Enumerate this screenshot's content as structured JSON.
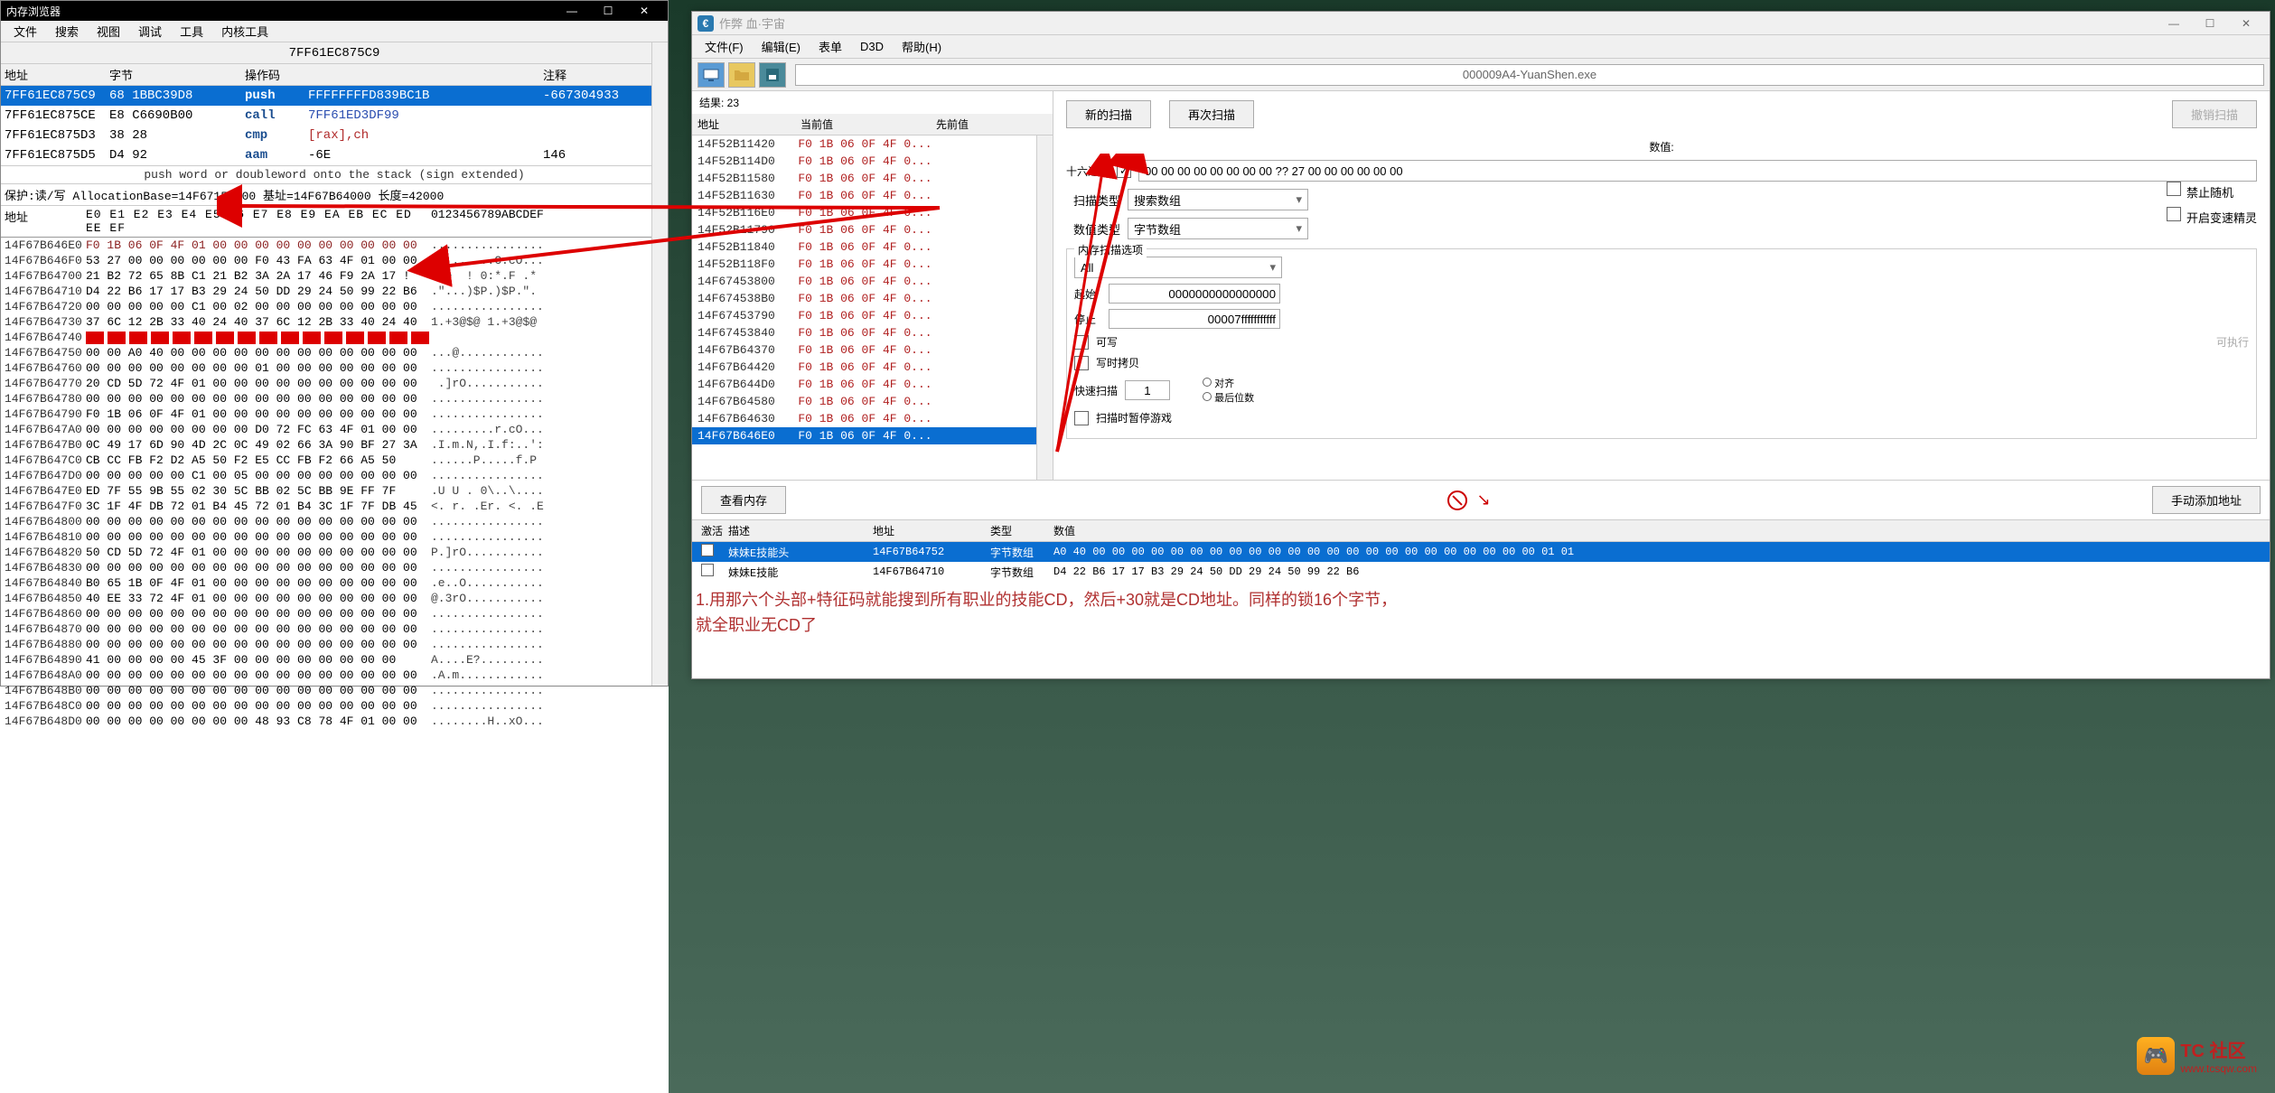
{
  "left": {
    "title": "内存浏览器",
    "menu": [
      "文件",
      "搜索",
      "视图",
      "调试",
      "工具",
      "内核工具"
    ],
    "addr_bar": "7FF61EC875C9",
    "disasm_headers": [
      "地址",
      "字节",
      "操作码",
      "",
      "注释"
    ],
    "disasm": [
      {
        "addr": "7FF61EC875C9",
        "bytes": "68 1BBC39D8",
        "op": "push",
        "operand": "FFFFFFFFD839BC1B",
        "operand_cls": "op-green",
        "comment": "-667304933",
        "sel": true
      },
      {
        "addr": "7FF61EC875CE",
        "bytes": "E8 C6690B00",
        "op": "call",
        "operand": "7FF61ED3DF99",
        "operand_cls": "op-blue",
        "comment": ""
      },
      {
        "addr": "7FF61EC875D3",
        "bytes": "38 28",
        "op": "cmp",
        "operand": "[rax],ch",
        "operand_cls": "op-red",
        "comment": ""
      },
      {
        "addr": "7FF61EC875D5",
        "bytes": "D4 92",
        "op": "aam",
        "operand": "-6E",
        "operand_cls": "",
        "comment": "146"
      }
    ],
    "push_hint": "push word or doubleword onto the stack (sign extended)",
    "alloc": "保护:读/写  AllocationBase=14F67150000  基址=14F67B64000 长度=42000",
    "hex_header_addr": "地址",
    "hex_header_bytes": "E0 E1 E2 E3 E4 E5 E6 E7 E8 E9 EA EB EC ED EE EF",
    "hex_header_ascii": "0123456789ABCDEF",
    "hex": [
      {
        "a": "14F67B646E0",
        "b": "F0 1B 06 0F 4F 01 00 00 00 00 00 00 00 00 00 00",
        "c": "................",
        "br": true
      },
      {
        "a": "14F67B646F0",
        "b": "53 27 00 00 00 00 00 00 F0 43 FA 63 4F 01 00 00",
        "c": "S'.......C.cO..."
      },
      {
        "a": "14F67B64700",
        "b": "21 B2 72 65 8B C1 21 B2 3A 2A 17 46 F9 2A 17 !",
        "c": " re  ! 0:*.F .*"
      },
      {
        "a": "14F67B64710",
        "b": "D4 22 B6 17 17 B3 29 24 50 DD 29 24 50 99 22 B6",
        "c": ".\"...)$P.)$P.\"."
      },
      {
        "a": "14F67B64720",
        "b": "00 00 00 00 00 C1 00 02 00 00 00 00 00 00 00 00",
        "c": "................"
      },
      {
        "a": "14F67B64730",
        "b": "37 6C 12 2B 33 40 24 40 37 6C 12 2B 33 40 24 40",
        "c": "1.+3@$@ 1.+3@$@",
        "red": true
      },
      {
        "a": "14F67B64740",
        "b": "",
        "c": "",
        "redbar": true
      },
      {
        "a": "14F67B64750",
        "b": "00 00 A0 40 00 00 00 00 00 00 00 00 00 00 00 00",
        "c": "...@............"
      },
      {
        "a": "14F67B64760",
        "b": "00 00 00 00 00 00 00 00 01 00 00 00 00 00 00 00",
        "c": "................"
      },
      {
        "a": "14F67B64770",
        "b": "20 CD 5D 72 4F 01 00 00 00 00 00 00 00 00 00 00",
        "c": " .]rO..........."
      },
      {
        "a": "14F67B64780",
        "b": "00 00 00 00 00 00 00 00 00 00 00 00 00 00 00 00",
        "c": "................"
      },
      {
        "a": "14F67B64790",
        "b": "F0 1B 06 0F 4F 01 00 00 00 00 00 00 00 00 00 00",
        "c": "................"
      },
      {
        "a": "14F67B647A0",
        "b": "00 00 00 00 00 00 00 00 D0 72 FC 63 4F 01 00 00",
        "c": ".........r.cO..."
      },
      {
        "a": "14F67B647B0",
        "b": "0C 49 17 6D 90 4D 2C 0C 49 02 66 3A 90 BF 27 3A",
        "c": ".I.m.N,.I.f:..':"
      },
      {
        "a": "14F67B647C0",
        "b": "CB CC FB F2 D2 A5 50 F2 E5 CC FB F2 66 A5 50",
        "c": "......P.....f.P"
      },
      {
        "a": "14F67B647D0",
        "b": "00 00 00 00 00 C1 00 05 00 00 00 00 00 00 00 00",
        "c": "................"
      },
      {
        "a": "14F67B647E0",
        "b": "ED 7F 55 9B 55 02 30 5C BB 02 5C BB 9E FF 7F",
        "c": ".U U . 0\\..\\...."
      },
      {
        "a": "14F67B647F0",
        "b": "3C 1F 4F DB 72 01 B4 45 72 01 B4 3C 1F 7F DB 45",
        "c": "<. r. .Er. <. .E"
      },
      {
        "a": "14F67B64800",
        "b": "00 00 00 00 00 00 00 00 00 00 00 00 00 00 00 00",
        "c": "................"
      },
      {
        "a": "14F67B64810",
        "b": "00 00 00 00 00 00 00 00 00 00 00 00 00 00 00 00",
        "c": "................"
      },
      {
        "a": "14F67B64820",
        "b": "50 CD 5D 72 4F 01 00 00 00 00 00 00 00 00 00 00",
        "c": "P.]rO..........."
      },
      {
        "a": "14F67B64830",
        "b": "00 00 00 00 00 00 00 00 00 00 00 00 00 00 00 00",
        "c": "................"
      },
      {
        "a": "14F67B64840",
        "b": "B0 65 1B 0F 4F 01 00 00 00 00 00 00 00 00 00 00",
        "c": ".e..O..........."
      },
      {
        "a": "14F67B64850",
        "b": "40 EE 33 72 4F 01 00 00 00 00 00 00 00 00 00 00",
        "c": "@.3rO..........."
      },
      {
        "a": "14F67B64860",
        "b": "00 00 00 00 00 00 00 00 00 00 00 00 00 00 00 00",
        "c": "................"
      },
      {
        "a": "14F67B64870",
        "b": "00 00 00 00 00 00 00 00 00 00 00 00 00 00 00 00",
        "c": "................"
      },
      {
        "a": "14F67B64880",
        "b": "00 00 00 00 00 00 00 00 00 00 00 00 00 00 00 00",
        "c": "................"
      },
      {
        "a": "14F67B64890",
        "b": "41 00 00 00 00 45 3F 00 00 00 00 00 00 00 00",
        "c": "A....E?........."
      },
      {
        "a": "14F67B648A0",
        "b": "00 00 00 00 00 00 00 00 00 00 00 00 00 00 00 00",
        "c": ".A.m............"
      },
      {
        "a": "14F67B648B0",
        "b": "00 00 00 00 00 00 00 00 00 00 00 00 00 00 00 00",
        "c": "................"
      },
      {
        "a": "14F67B648C0",
        "b": "00 00 00 00 00 00 00 00 00 00 00 00 00 00 00 00",
        "c": "................"
      },
      {
        "a": "14F67B648D0",
        "b": "00 00 00 00 00 00 00 00 48 93 C8 78 4F 01 00 00",
        "c": "........H..xO..."
      }
    ]
  },
  "right": {
    "title": "作弊 血·宇宙",
    "menu": [
      "文件(F)",
      "编辑(E)",
      "表单",
      "D3D",
      "帮助(H)"
    ],
    "process": "000009A4-YuanShen.exe",
    "result_count": "结果: 23",
    "result_headers": [
      "地址",
      "当前值",
      "先前值"
    ],
    "results": [
      {
        "addr": "14F52B11420",
        "val": "F0 1B 06 0F 4F 0..."
      },
      {
        "addr": "14F52B114D0",
        "val": "F0 1B 06 0F 4F 0..."
      },
      {
        "addr": "14F52B11580",
        "val": "F0 1B 06 0F 4F 0..."
      },
      {
        "addr": "14F52B11630",
        "val": "F0 1B 06 0F 4F 0..."
      },
      {
        "addr": "14F52B116E0",
        "val": "F0 1B 06 0F 4F 0..."
      },
      {
        "addr": "14F52B11790",
        "val": "F0 1B 06 0F 4F 0..."
      },
      {
        "addr": "14F52B11840",
        "val": "F0 1B 06 0F 4F 0..."
      },
      {
        "addr": "14F52B118F0",
        "val": "F0 1B 06 0F 4F 0..."
      },
      {
        "addr": "14F67453800",
        "val": "F0 1B 06 0F 4F 0..."
      },
      {
        "addr": "14F674538B0",
        "val": "F0 1B 06 0F 4F 0..."
      },
      {
        "addr": "14F67453790",
        "val": "F0 1B 06 0F 4F 0..."
      },
      {
        "addr": "14F67453840",
        "val": "F0 1B 06 0F 4F 0..."
      },
      {
        "addr": "14F67B64370",
        "val": "F0 1B 06 0F 4F 0..."
      },
      {
        "addr": "14F67B64420",
        "val": "F0 1B 06 0F 4F 0..."
      },
      {
        "addr": "14F67B644D0",
        "val": "F0 1B 06 0F 4F 0..."
      },
      {
        "addr": "14F67B64580",
        "val": "F0 1B 06 0F 4F 0..."
      },
      {
        "addr": "14F67B64630",
        "val": "F0 1B 06 0F 4F 0..."
      },
      {
        "addr": "14F67B646E0",
        "val": "F0 1B 06 0F 4F 0...",
        "sel": true
      }
    ],
    "btn_new_scan": "新的扫描",
    "btn_next_scan": "再次扫描",
    "btn_undo": "撤销扫描",
    "lbl_value": "数值:",
    "lbl_hex": "十六进制",
    "hex_checked": true,
    "value_input": "00 00 00 00 00 00 00 00 ?? 27 00 00 00 00 00 00",
    "lbl_scan_type": "扫描类型",
    "scan_type": "搜索数组",
    "lbl_value_type": "数值类型",
    "value_type": "字节数组",
    "scan_opts_legend": "内存扫描选项",
    "opt_all": "All",
    "lbl_start": "起始",
    "start_val": "0000000000000000",
    "lbl_stop": "停止",
    "stop_val": "00007fffffffffff",
    "chk_writable": "可写",
    "chk_exec": "可执行",
    "chk_cow": "写时拷贝",
    "lbl_fast": "快速扫描",
    "fast_val": "1",
    "chk_align": "对齐",
    "chk_last": "最后位数",
    "chk_pause": "扫描时暂停游戏",
    "chk_no_random": "禁止随机",
    "chk_speed": "开启变速精灵",
    "btn_view_mem": "查看内存",
    "btn_manual_add": "手动添加地址",
    "table_headers": [
      "激活",
      "描述",
      "地址",
      "类型",
      "数值"
    ],
    "table_rows": [
      {
        "desc": "妹妹E技能头",
        "addr": "14F67B64752",
        "type": "字节数组",
        "val": "A0 40 00 00 00 00 00 00 00 00 00 00 00 00 00 00 00 00 00 00 00 00 00 00 00 01 01",
        "sel": true
      },
      {
        "desc": "妹妹E技能",
        "addr": "14F67B64710",
        "type": "字节数组",
        "val": "D4 22 B6 17 17 B3 29 24 50 DD 29 24 50 99 22 B6"
      }
    ]
  },
  "note": "1.用那六个头部+特征码就能搜到所有职业的技能CD，然后+30就是CD地址。同样的锁16个字节，就全职业无CD了",
  "watermark": {
    "t1": "TC 社区",
    "t2": "www.tcsqw.com"
  }
}
